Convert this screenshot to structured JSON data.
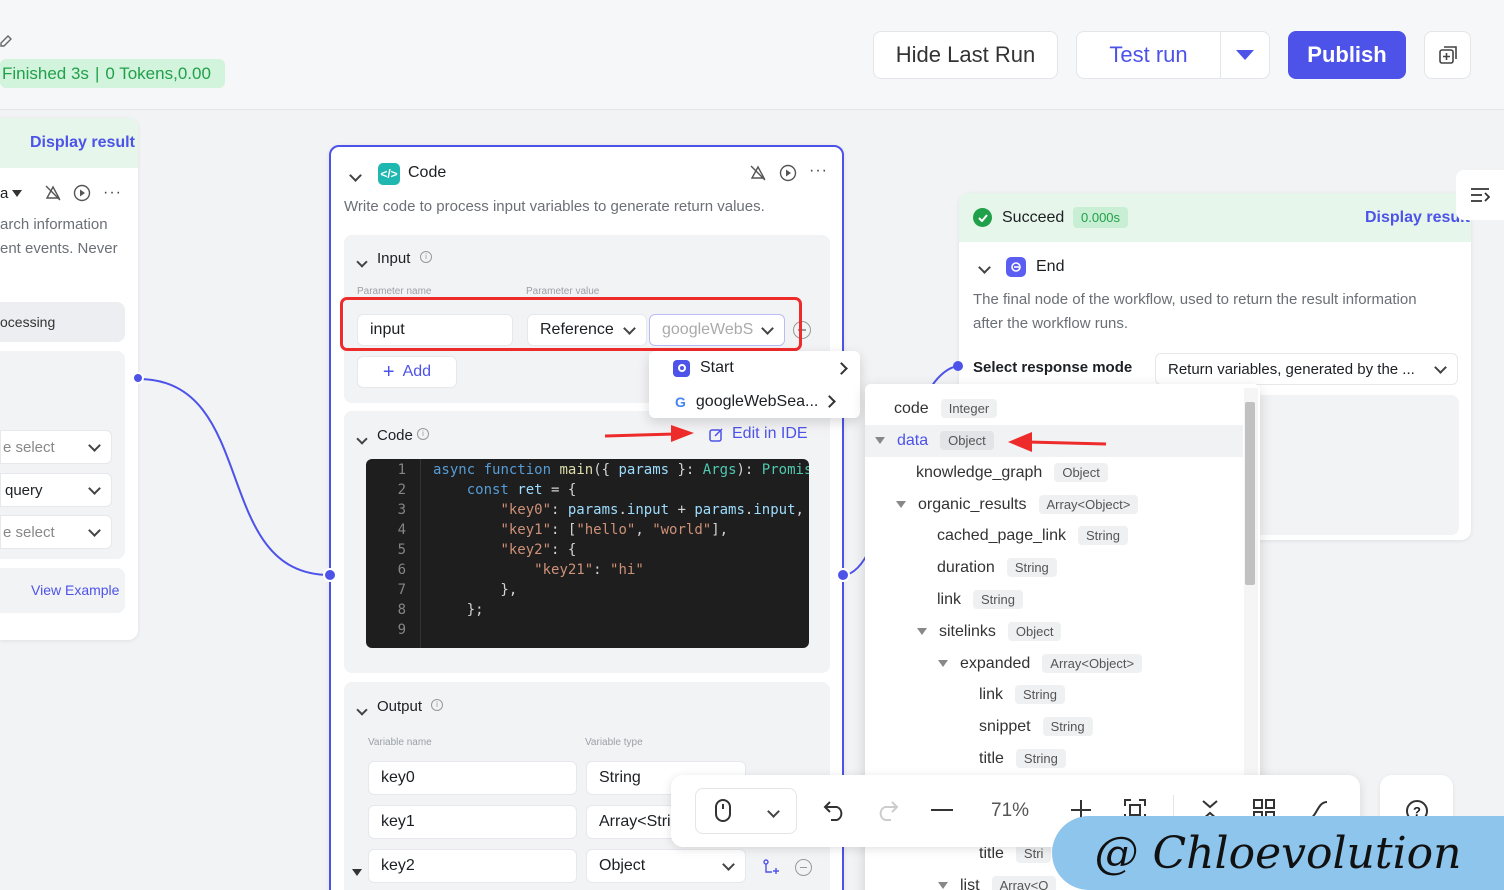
{
  "topbar": {
    "status": "Finished 3s",
    "tokens": "0 Tokens,0.00",
    "hide_last_run": "Hide Last Run",
    "test_run": "Test run",
    "publish": "Publish"
  },
  "left_node": {
    "display_result": "Display result",
    "name_fragment": "a",
    "desc_line1": "arch information",
    "desc_line2": "ent events. Never",
    "processing": "ocessing",
    "select1": "e select",
    "select2": "query",
    "select3": "e select",
    "view_example": "View Example"
  },
  "code_node": {
    "title": "Code",
    "description": "Write code to process input variables to generate return values.",
    "input_label": "Input",
    "param_name_header": "Parameter name",
    "param_value_header": "Parameter value",
    "param_name": "input",
    "param_type": "Reference",
    "param_value_placeholder": "googleWebSe",
    "add_label": "Add",
    "code_label": "Code",
    "edit_in_ide": "Edit in IDE",
    "code_lines": [
      {
        "n": "1",
        "t": "async function main({ params }: Args): Promise"
      },
      {
        "n": "2",
        "t": "    const ret = {"
      },
      {
        "n": "3",
        "t": "        \"key0\": params.input + params.input,"
      },
      {
        "n": "4",
        "t": "        \"key1\": [\"hello\", \"world\"],"
      },
      {
        "n": "5",
        "t": "        \"key2\": {"
      },
      {
        "n": "6",
        "t": "            \"key21\": \"hi\""
      },
      {
        "n": "7",
        "t": "        },"
      },
      {
        "n": "8",
        "t": "    };"
      },
      {
        "n": "9",
        "t": ""
      }
    ],
    "output_label": "Output",
    "var_name_header": "Variable name",
    "var_type_header": "Variable type",
    "outputs": [
      {
        "name": "key0",
        "type": "String"
      },
      {
        "name": "key1",
        "type": "Array<Stri"
      },
      {
        "name": "key2",
        "type": "Object"
      }
    ]
  },
  "ref_dropdown": {
    "items": [
      "Start",
      "googleWebSea..."
    ]
  },
  "end_node": {
    "succeed": "Succeed",
    "time": "0.000s",
    "display_result": "Display result",
    "title": "End",
    "description_line1": "The final node of the workflow, used to return the result information",
    "description_line2": "after the workflow runs.",
    "response_mode_label": "Select response mode",
    "response_mode_value": "Return variables, generated by the ..."
  },
  "var_tree": {
    "rows": [
      {
        "name": "code",
        "type": "Integer"
      },
      {
        "name": "data",
        "type": "Object"
      },
      {
        "name": "knowledge_graph",
        "type": "Object"
      },
      {
        "name": "organic_results",
        "type": "Array<Object>"
      },
      {
        "name": "cached_page_link",
        "type": "String"
      },
      {
        "name": "duration",
        "type": "String"
      },
      {
        "name": "link",
        "type": "String"
      },
      {
        "name": "sitelinks",
        "type": "Object"
      },
      {
        "name": "expanded",
        "type": "Array<Object>"
      },
      {
        "name": "link",
        "type": "String"
      },
      {
        "name": "snippet",
        "type": "String"
      },
      {
        "name": "title",
        "type": "String"
      },
      {
        "name": "title",
        "type": "Stri"
      },
      {
        "name": "list",
        "type": "Array<O"
      }
    ]
  },
  "toolbar": {
    "zoom": "71%"
  },
  "watermark": "@ Chloevolution",
  "colors": {
    "brand": "#4d53e8",
    "success_bg": "#d2f3dc",
    "success_text": "#21a04b",
    "highlight_red": "#ee2b2b"
  }
}
